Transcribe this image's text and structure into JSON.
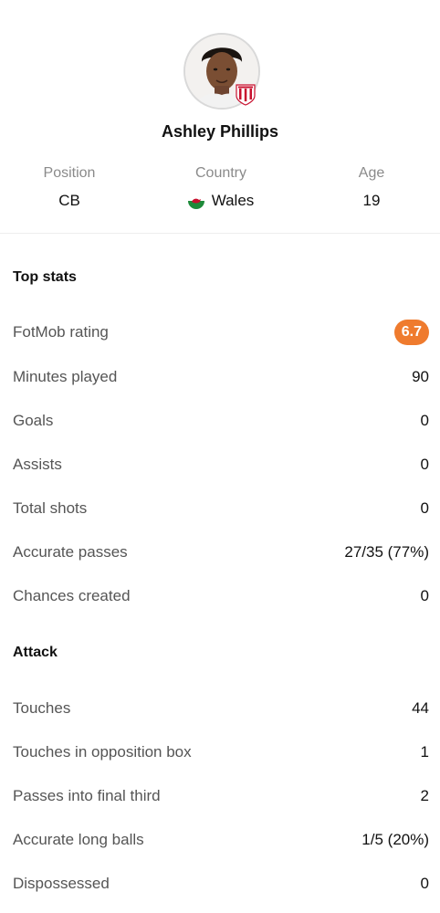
{
  "player": {
    "name": "Ashley Phillips",
    "position_label": "Position",
    "position": "CB",
    "country_label": "Country",
    "country": "Wales",
    "age_label": "Age",
    "age": "19",
    "team_badge_icon": "stoke-city-badge-icon",
    "flag_icon": "wales-flag-icon"
  },
  "colors": {
    "rating_badge": "#ef7b2e",
    "label": "#555555",
    "muted": "#8a8a8a"
  },
  "top_stats": {
    "title": "Top stats",
    "rows": [
      {
        "label": "FotMob rating",
        "value": "6.7"
      },
      {
        "label": "Minutes played",
        "value": "90"
      },
      {
        "label": "Goals",
        "value": "0"
      },
      {
        "label": "Assists",
        "value": "0"
      },
      {
        "label": "Total shots",
        "value": "0"
      },
      {
        "label": "Accurate passes",
        "value": "27/35 (77%)"
      },
      {
        "label": "Chances created",
        "value": "0"
      }
    ]
  },
  "attack": {
    "title": "Attack",
    "rows": [
      {
        "label": "Touches",
        "value": "44"
      },
      {
        "label": "Touches in opposition box",
        "value": "1"
      },
      {
        "label": "Passes into final third",
        "value": "2"
      },
      {
        "label": "Accurate long balls",
        "value": "1/5 (20%)"
      },
      {
        "label": "Dispossessed",
        "value": "0"
      }
    ]
  }
}
